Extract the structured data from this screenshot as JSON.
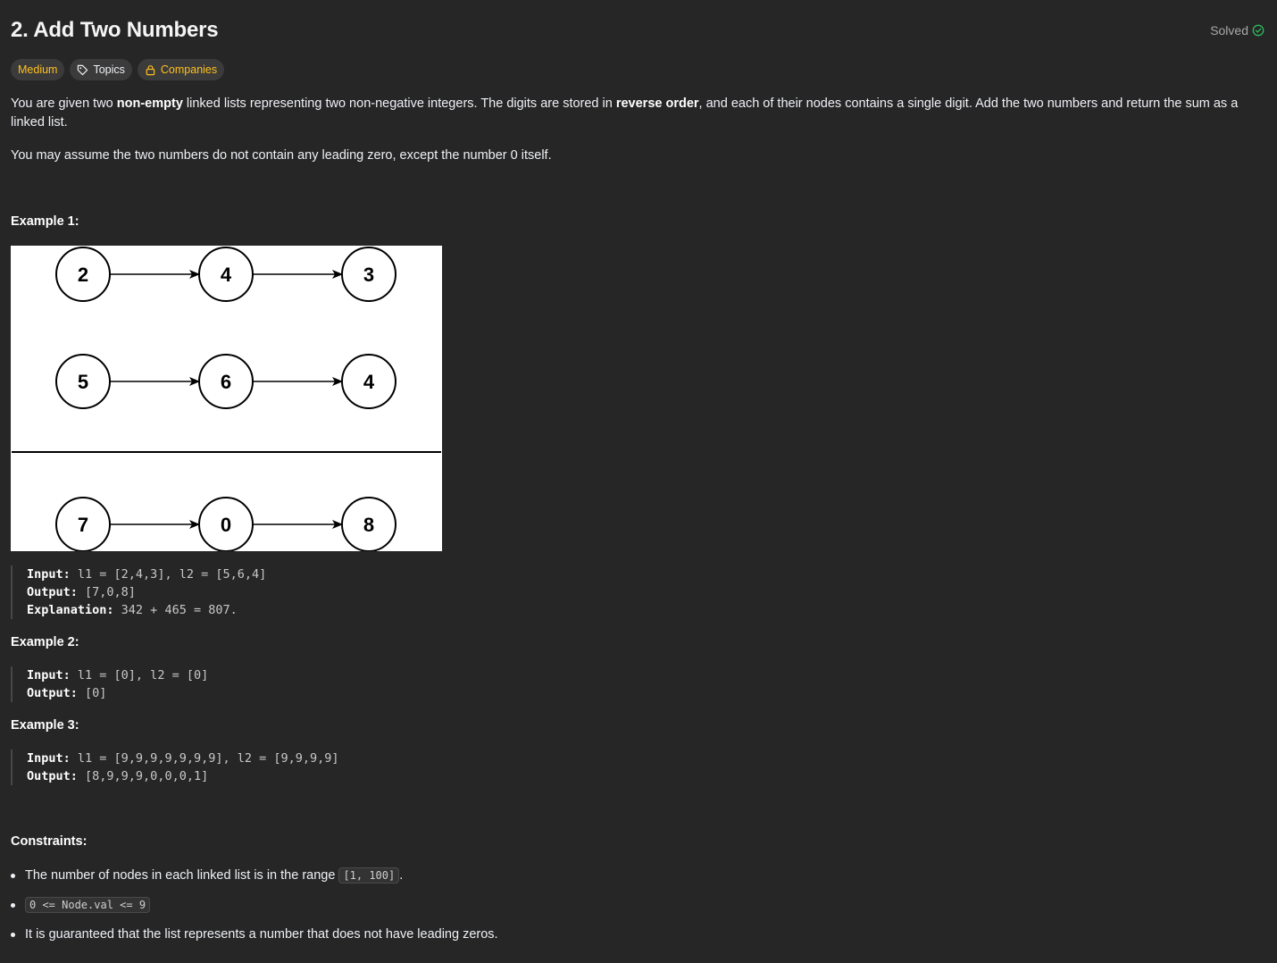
{
  "problem": {
    "title": "2. Add Two Numbers",
    "status": "Solved",
    "tags": {
      "difficulty": "Medium",
      "topics": "Topics",
      "companies": "Companies"
    },
    "description": {
      "p1_a": "You are given two ",
      "p1_b": "non-empty",
      "p1_c": " linked lists representing two non-negative integers. The digits are stored in ",
      "p1_d": "reverse order",
      "p1_e": ", and each of their nodes contains a single digit. Add the two numbers and return the sum as a linked list.",
      "p2": "You may assume the two numbers do not contain any leading zero, except the number 0 itself."
    }
  },
  "examples": [
    {
      "title": "Example 1:",
      "input_label": "Input:",
      "input": " l1 = [2,4,3], l2 = [5,6,4]",
      "output_label": "Output:",
      "output": " [7,0,8]",
      "explanation_label": "Explanation:",
      "explanation": " 342 + 465 = 807."
    },
    {
      "title": "Example 2:",
      "input_label": "Input:",
      "input": " l1 = [0], l2 = [0]",
      "output_label": "Output:",
      "output": " [0]"
    },
    {
      "title": "Example 3:",
      "input_label": "Input:",
      "input": " l1 = [9,9,9,9,9,9,9], l2 = [9,9,9,9]",
      "output_label": "Output:",
      "output": " [8,9,9,9,0,0,0,1]"
    }
  ],
  "diagram": {
    "rows": [
      [
        "2",
        "4",
        "3"
      ],
      [
        "5",
        "6",
        "4"
      ],
      [
        "7",
        "0",
        "8"
      ]
    ]
  },
  "constraints": {
    "title": "Constraints:",
    "c1_text": "The number of nodes in each linked list is in the range ",
    "c1_code": "[1, 100]",
    "c1_end": ".",
    "c2_code": "0 <= Node.val <= 9",
    "c3_text": "It is guaranteed that the list represents a number that does not have leading zeros."
  },
  "colors": {
    "background": "#262626",
    "medium": "#ffc01e",
    "solved_check": "#2cbb5d"
  },
  "icons": {
    "status": "check-circle-icon",
    "topics": "tag-icon",
    "companies": "lock-icon"
  }
}
